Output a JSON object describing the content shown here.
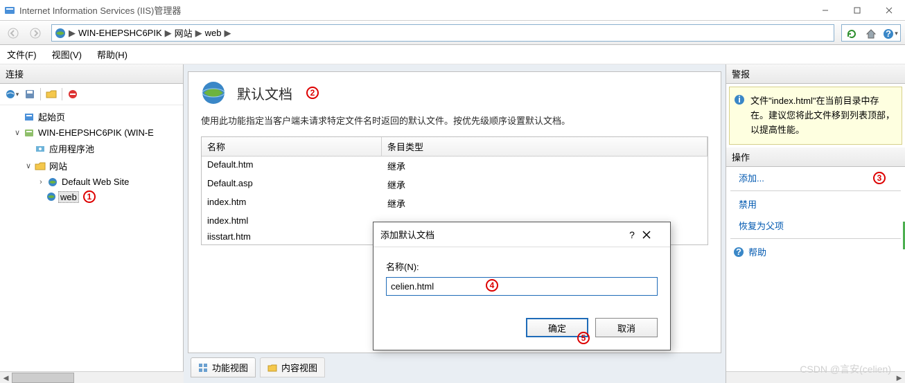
{
  "titlebar": {
    "title": "Internet Information Services (IIS)管理器"
  },
  "breadcrumb": {
    "root": "WIN-EHEPSHC6PIK",
    "part1": "网站",
    "part2": "web"
  },
  "menubar": {
    "file": "文件(F)",
    "view": "视图(V)",
    "help": "帮助(H)"
  },
  "leftpane": {
    "header": "连接",
    "items": {
      "start": "起始页",
      "server": "WIN-EHEPSHC6PIK (WIN-E",
      "apppool": "应用程序池",
      "sites": "网站",
      "default_site": "Default Web Site",
      "web": "web"
    }
  },
  "center": {
    "title": "默认文档",
    "desc": "使用此功能指定当客户端未请求特定文件名时返回的默认文件。按优先级顺序设置默认文档。",
    "col1": "名称",
    "col2": "条目类型",
    "rows": [
      {
        "name": "Default.htm",
        "type": "继承"
      },
      {
        "name": "Default.asp",
        "type": "继承"
      },
      {
        "name": "index.htm",
        "type": "继承"
      },
      {
        "name": "index.html",
        "type": ""
      },
      {
        "name": "iisstart.htm",
        "type": ""
      }
    ],
    "tabs": {
      "features": "功能视图",
      "content": "内容视图"
    }
  },
  "rightpane": {
    "alert_header": "警报",
    "alert_text": "文件\"index.html\"在当前目录中存在。建议您将此文件移到列表顶部，以提高性能。",
    "actions_header": "操作",
    "add": "添加...",
    "disable": "禁用",
    "revert": "恢复为父项",
    "help": "帮助"
  },
  "dialog": {
    "title": "添加默认文档",
    "label": "名称(N):",
    "value": "celien.html",
    "ok": "确定",
    "cancel": "取消",
    "help": "?",
    "close": "✕"
  },
  "annotations": {
    "a1": "1",
    "a2": "2",
    "a3": "3",
    "a4": "4",
    "a5": "5"
  },
  "watermark": "CSDN @言安(celien)"
}
